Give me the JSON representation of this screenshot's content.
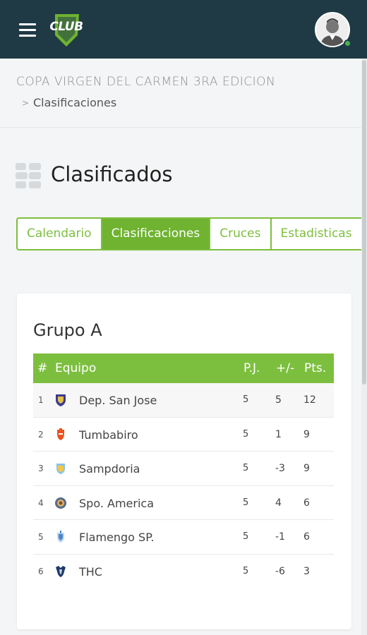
{
  "header": {
    "logo_text": "CLUB",
    "colors": {
      "bar": "#1f3a44",
      "accent": "#7cbf3e",
      "online": "#4caf50"
    }
  },
  "breadcrumb": {
    "root": "COPA VIRGEN DEL CARMEN 3RA EDICION",
    "separator": ">",
    "current": "Clasificaciones"
  },
  "page": {
    "title": "Clasificados",
    "icon": "grid-icon"
  },
  "tabs": [
    {
      "label": "Calendario",
      "active": false
    },
    {
      "label": "Clasificaciones",
      "active": true
    },
    {
      "label": "Cruces",
      "active": false
    },
    {
      "label": "Estadisticas",
      "active": false
    }
  ],
  "group": {
    "title": "Grupo A",
    "columns": {
      "num": "#",
      "team": "Equipo",
      "pj": "P.J.",
      "dif": "+/-",
      "pts": "Pts."
    },
    "rows": [
      {
        "num": "1",
        "team": "Dep. San Jose",
        "pj": "5",
        "dif": "5",
        "pts": "12",
        "crest": "shield-crest-icon"
      },
      {
        "num": "2",
        "team": "Tumbabiro",
        "pj": "5",
        "dif": "1",
        "pts": "9",
        "crest": "orange-crest-icon"
      },
      {
        "num": "3",
        "team": "Sampdoria",
        "pj": "5",
        "dif": "-3",
        "pts": "9",
        "crest": "blue-crest-icon"
      },
      {
        "num": "4",
        "team": "Spo. America",
        "pj": "5",
        "dif": "4",
        "pts": "6",
        "crest": "round-crest-icon"
      },
      {
        "num": "5",
        "team": "Flamengo SP.",
        "pj": "5",
        "dif": "-1",
        "pts": "6",
        "crest": "light-blue-crest-icon"
      },
      {
        "num": "6",
        "team": "THC",
        "pj": "5",
        "dif": "-6",
        "pts": "3",
        "crest": "dark-crest-icon"
      }
    ]
  }
}
